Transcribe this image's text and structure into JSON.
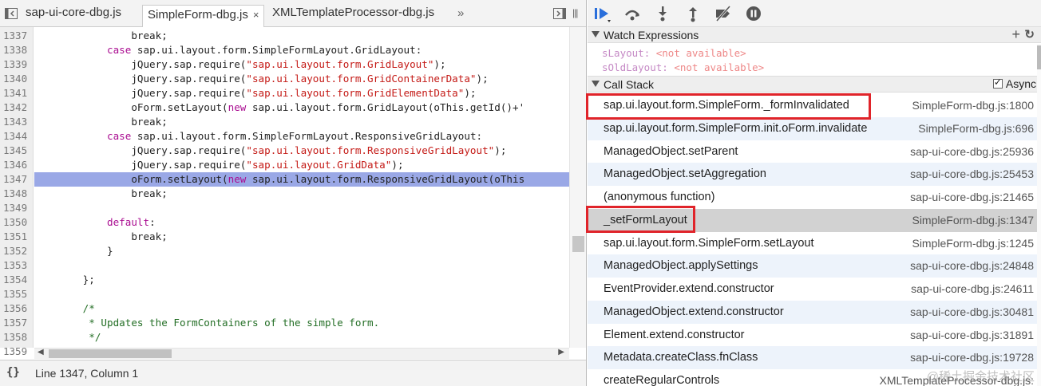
{
  "tabs": {
    "items": [
      {
        "label": "sap-ui-core-dbg.js"
      },
      {
        "label": "SimpleForm-dbg.js",
        "close": "×"
      },
      {
        "label": "XMLTemplateProcessor-dbg.js"
      }
    ],
    "overflow": "»"
  },
  "editor": {
    "lines": [
      {
        "n": "1337",
        "t": [
          {
            "c": "",
            "s": "                break;"
          }
        ]
      },
      {
        "n": "1338",
        "t": [
          {
            "c": "",
            "s": "            "
          },
          {
            "c": "kw",
            "s": "case"
          },
          {
            "c": "",
            "s": " sap.ui.layout.form.SimpleFormLayout.GridLayout:"
          }
        ]
      },
      {
        "n": "1339",
        "t": [
          {
            "c": "",
            "s": "                jQuery.sap.require("
          },
          {
            "c": "str",
            "s": "\"sap.ui.layout.form.GridLayout\""
          },
          {
            "c": "",
            "s": ");"
          }
        ]
      },
      {
        "n": "1340",
        "t": [
          {
            "c": "",
            "s": "                jQuery.sap.require("
          },
          {
            "c": "str",
            "s": "\"sap.ui.layout.form.GridContainerData\""
          },
          {
            "c": "",
            "s": ");"
          }
        ]
      },
      {
        "n": "1341",
        "t": [
          {
            "c": "",
            "s": "                jQuery.sap.require("
          },
          {
            "c": "str",
            "s": "\"sap.ui.layout.form.GridElementData\""
          },
          {
            "c": "",
            "s": ");"
          }
        ]
      },
      {
        "n": "1342",
        "t": [
          {
            "c": "",
            "s": "                oForm.setLayout("
          },
          {
            "c": "kw",
            "s": "new"
          },
          {
            "c": "",
            "s": " sap.ui.layout.form.GridLayout(oThis.getId()+'"
          }
        ]
      },
      {
        "n": "1343",
        "t": [
          {
            "c": "",
            "s": "                break;"
          }
        ]
      },
      {
        "n": "1344",
        "t": [
          {
            "c": "",
            "s": "            "
          },
          {
            "c": "kw",
            "s": "case"
          },
          {
            "c": "",
            "s": " sap.ui.layout.form.SimpleFormLayout.ResponsiveGridLayout:"
          }
        ]
      },
      {
        "n": "1345",
        "t": [
          {
            "c": "",
            "s": "                jQuery.sap.require("
          },
          {
            "c": "str",
            "s": "\"sap.ui.layout.form.ResponsiveGridLayout\""
          },
          {
            "c": "",
            "s": ");"
          }
        ]
      },
      {
        "n": "1346",
        "t": [
          {
            "c": "",
            "s": "                jQuery.sap.require("
          },
          {
            "c": "str",
            "s": "\"sap.ui.layout.GridData\""
          },
          {
            "c": "",
            "s": ");"
          }
        ]
      },
      {
        "n": "1347",
        "hl": true,
        "t": [
          {
            "c": "",
            "s": "                oForm.setLayout("
          },
          {
            "c": "kw",
            "s": "new"
          },
          {
            "c": "",
            "s": " sap.ui.layout.form.ResponsiveGridLayout(oThis"
          }
        ]
      },
      {
        "n": "1348",
        "t": [
          {
            "c": "",
            "s": "                break;"
          }
        ]
      },
      {
        "n": "1349",
        "t": [
          {
            "c": "",
            "s": ""
          }
        ]
      },
      {
        "n": "1350",
        "t": [
          {
            "c": "",
            "s": "            "
          },
          {
            "c": "kw",
            "s": "default"
          },
          {
            "c": "",
            "s": ":"
          }
        ]
      },
      {
        "n": "1351",
        "t": [
          {
            "c": "",
            "s": "                break;"
          }
        ]
      },
      {
        "n": "1352",
        "t": [
          {
            "c": "",
            "s": "            }"
          }
        ]
      },
      {
        "n": "1353",
        "t": [
          {
            "c": "",
            "s": ""
          }
        ]
      },
      {
        "n": "1354",
        "t": [
          {
            "c": "",
            "s": "        };"
          }
        ]
      },
      {
        "n": "1355",
        "t": [
          {
            "c": "",
            "s": ""
          }
        ]
      },
      {
        "n": "1356",
        "t": [
          {
            "c": "com",
            "s": "        /*"
          }
        ]
      },
      {
        "n": "1357",
        "t": [
          {
            "c": "com",
            "s": "         * Updates the FormContainers of the simple form."
          }
        ]
      },
      {
        "n": "1358",
        "t": [
          {
            "c": "com",
            "s": "         */"
          }
        ]
      },
      {
        "n": "1359",
        "t": [
          {
            "c": "",
            "s": ""
          }
        ]
      }
    ]
  },
  "status": {
    "brace": "{}",
    "text": "Line 1347, Column 1"
  },
  "watch": {
    "title": "Watch Expressions",
    "items": [
      {
        "name": "sLayout",
        "value": "<not available>"
      },
      {
        "name": "sOldLayout",
        "value": "<not available>"
      }
    ]
  },
  "callstack": {
    "title": "Call Stack",
    "async_label": "Async",
    "frames": [
      {
        "fn": "sap.ui.layout.form.SimpleForm._formInvalidated",
        "loc": "SimpleForm-dbg.js:1800"
      },
      {
        "fn": "sap.ui.layout.form.SimpleForm.init.oForm.invalidate",
        "loc": "SimpleForm-dbg.js:696"
      },
      {
        "fn": "ManagedObject.setParent",
        "loc": "sap-ui-core-dbg.js:25936"
      },
      {
        "fn": "ManagedObject.setAggregation",
        "loc": "sap-ui-core-dbg.js:25453"
      },
      {
        "fn": "(anonymous function)",
        "loc": "sap-ui-core-dbg.js:21465"
      },
      {
        "fn": "_setFormLayout",
        "loc": "SimpleForm-dbg.js:1347"
      },
      {
        "fn": "sap.ui.layout.form.SimpleForm.setLayout",
        "loc": "SimpleForm-dbg.js:1245"
      },
      {
        "fn": "ManagedObject.applySettings",
        "loc": "sap-ui-core-dbg.js:24848"
      },
      {
        "fn": "EventProvider.extend.constructor",
        "loc": "sap-ui-core-dbg.js:24611"
      },
      {
        "fn": "ManagedObject.extend.constructor",
        "loc": "sap-ui-core-dbg.js:30481"
      },
      {
        "fn": "Element.extend.constructor",
        "loc": "sap-ui-core-dbg.js:31891"
      },
      {
        "fn": "Metadata.createClass.fnClass",
        "loc": "sap-ui-core-dbg.js:19728"
      },
      {
        "fn": "createRegularControls",
        "loc": "XMLTemplateProcessor-dbg.js:"
      }
    ]
  },
  "watermark": "@稀土掘金技术社区",
  "colors": {
    "highlight": "#9aa8e6",
    "redbox": "#e0242a",
    "resume_blue": "#2a6fdb"
  }
}
